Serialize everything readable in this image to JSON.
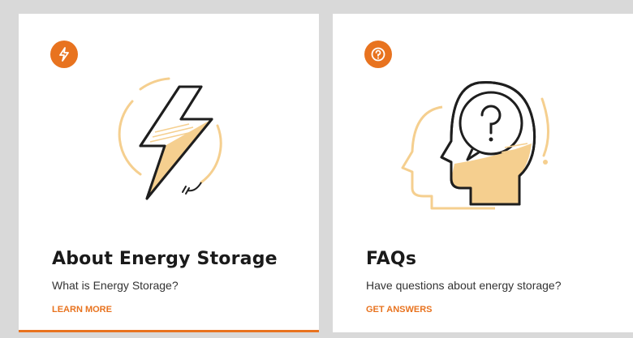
{
  "cards": [
    {
      "badge_icon": "lightning-icon",
      "illustration": "lightning-bolt-plug-icon",
      "title": "About Energy Storage",
      "description": "What is Energy Storage?",
      "cta": "LEARN MORE"
    },
    {
      "badge_icon": "question-icon",
      "illustration": "head-question-icon",
      "title": "FAQs",
      "description": "Have questions about energy storage?",
      "cta": "GET ANSWERS"
    }
  ],
  "colors": {
    "accent": "#e8731f",
    "illustration_fill": "#f5cf8f",
    "illustration_stroke": "#1e1e1e",
    "background": "#d9d9d9",
    "card": "#ffffff"
  }
}
